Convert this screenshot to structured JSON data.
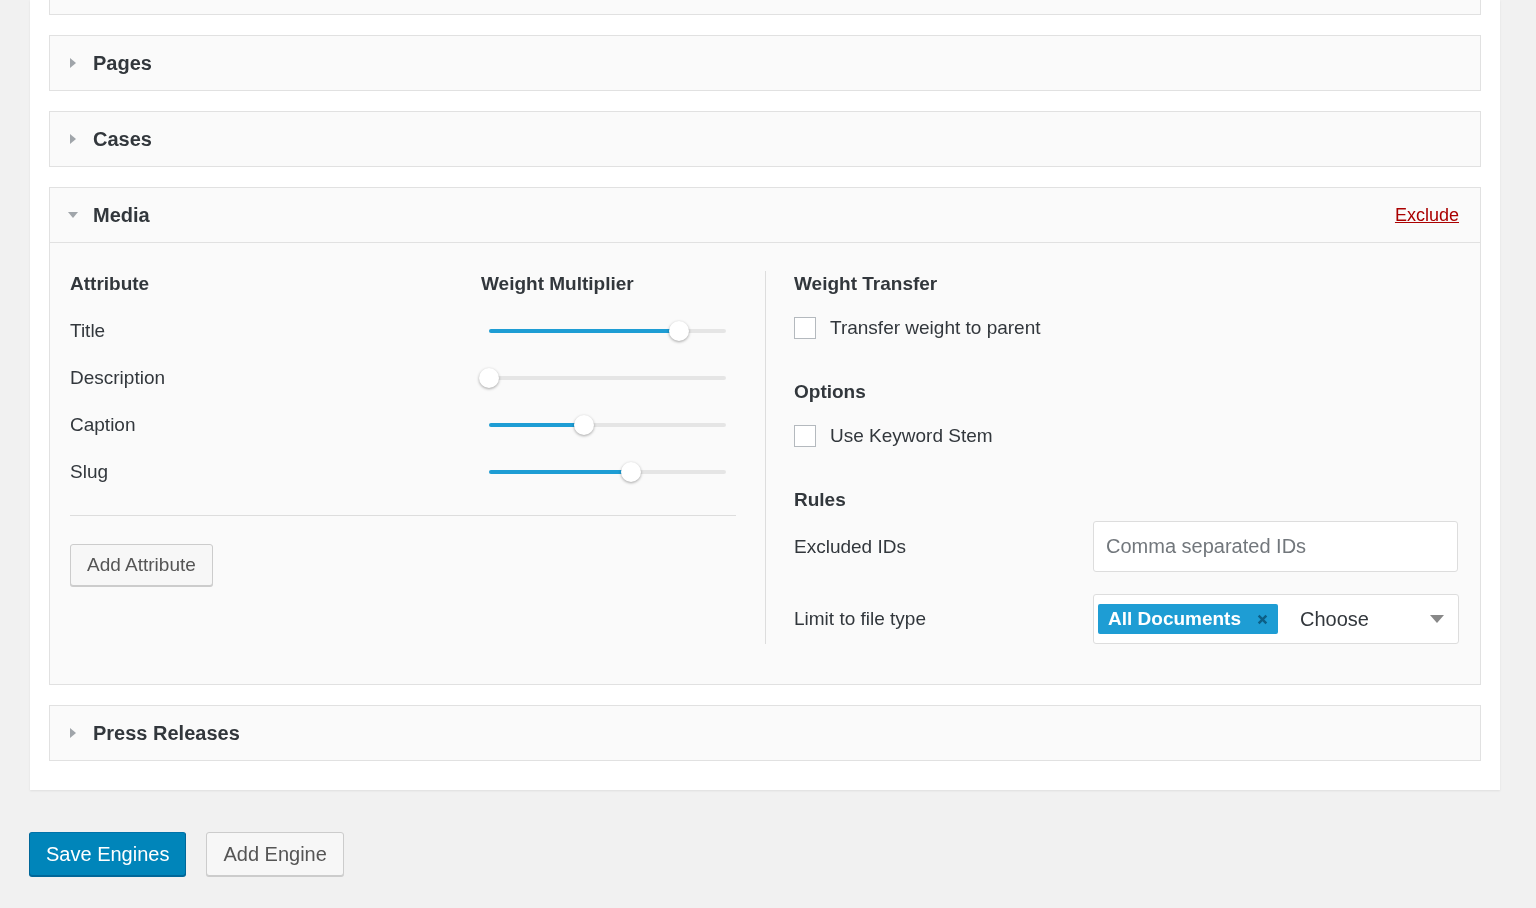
{
  "sections": [
    {
      "title": "Pages",
      "expanded": false
    },
    {
      "title": "Cases",
      "expanded": false
    },
    {
      "title": "Media",
      "expanded": true,
      "action": "Exclude",
      "attributes": {
        "heading": "Attribute",
        "weight_heading": "Weight Multiplier",
        "button": "Add Attribute",
        "rows": [
          {
            "label": "Title",
            "level": 0.8
          },
          {
            "label": "Description",
            "level": 0
          },
          {
            "label": "Caption",
            "level": 0.4
          },
          {
            "label": "Slug",
            "level": 0.6
          }
        ]
      },
      "weight_transfer": {
        "heading": "Weight Transfer",
        "label": "Transfer weight to parent",
        "checked": false
      },
      "options": {
        "heading": "Options",
        "label": "Use Keyword Stem",
        "checked": false
      },
      "rules": {
        "heading": "Rules",
        "excluded_label": "Excluded IDs",
        "excluded_placeholder": "Comma separated IDs",
        "limit_label": "Limit to file type",
        "tags": [
          "All Documents"
        ],
        "select_placeholder": "Choose"
      }
    },
    {
      "title": "Press Releases",
      "expanded": false
    }
  ],
  "buttons": [
    {
      "label": "Save Engines",
      "kind": "primary"
    },
    {
      "label": "Add Engine",
      "kind": "secondary"
    }
  ]
}
